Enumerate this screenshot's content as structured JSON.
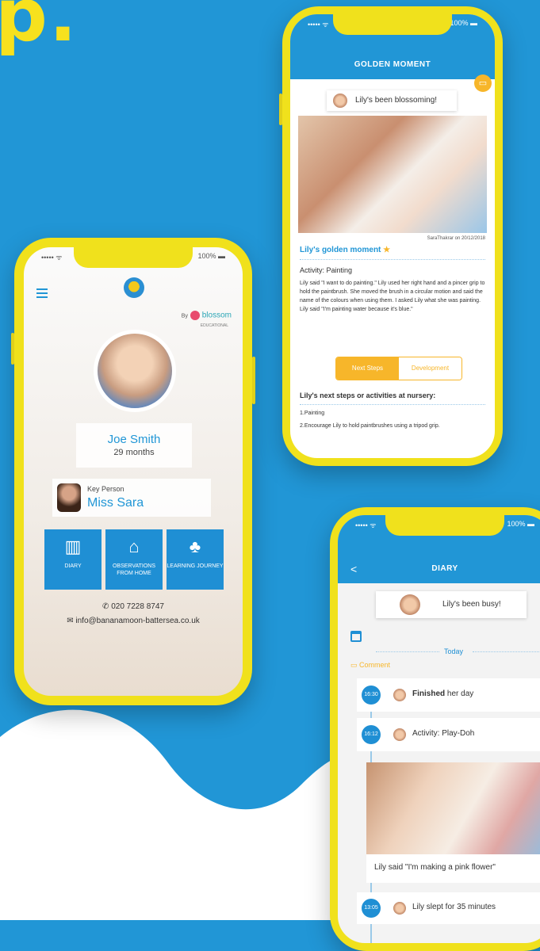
{
  "headline": "p.",
  "phone_profile": {
    "status": {
      "signal": "•••••  ᯤ",
      "battery": "100% ▬"
    },
    "brand": {
      "by_label": "By",
      "name": "blossom",
      "sub": "EDUCATIONAL"
    },
    "child": {
      "name": "Joe Smith",
      "age": "29 months"
    },
    "key_person": {
      "label": "Key Person",
      "name": "Miss Sara"
    },
    "tiles": [
      {
        "label": "DIARY",
        "icon": "notebook-icon"
      },
      {
        "label": "OBSERVATIONS FROM HOME",
        "icon": "house-icon"
      },
      {
        "label": "LEARNING JOURNEY",
        "icon": "tree-icon"
      }
    ],
    "contact": {
      "phone": "020 7228 8747",
      "email": "info@bananamoon-battersea.co.uk"
    }
  },
  "phone_moment": {
    "status": {
      "signal": "•••••  ᯤ",
      "battery": "100% ▬"
    },
    "title": "GOLDEN MOMENT",
    "summary": "Lily's been blossoming!",
    "photo_credit": "SaraThakrar on 20/12/2018",
    "moment_title": "Lily's golden moment",
    "activity": "Activity: Painting",
    "description": "Lily said \"I want to do painting.\" Lily used her right hand and a pincer grip to hold the paintbrush. She moved the brush in a circular motion and said the name of the colours when using them. I asked Lily what she was painting. Lily said \"I'm painting water because it's blue.\"",
    "tabs": [
      "Next Steps",
      "Development"
    ],
    "next_steps_title": "Lily's next steps or activities at nursery:",
    "next_steps": [
      "1.Painting",
      "2.Encourage Lily to hold paintbrushes using a tripod grip."
    ]
  },
  "phone_diary": {
    "status": {
      "signal": "•••••  ᯤ",
      "battery": "100% ▬"
    },
    "title": "DIARY",
    "back": "<",
    "summary": "Lily's been busy!",
    "today": "Today",
    "comment": "Comment",
    "entries": [
      {
        "time": "16:30",
        "bold": "Finished",
        "text": " her day"
      },
      {
        "time": "16:12",
        "bold": "",
        "text": "Activity: Play-Doh"
      },
      {
        "time": "13:05",
        "bold": "",
        "text": "Lily slept for 35 minutes"
      }
    ],
    "quote": "Lily said \"I'm making a pink flower\""
  },
  "colors": {
    "background": "#2196d6",
    "phone_frame": "#f0e11c",
    "accent_orange": "#f7b62a",
    "brand_blue": "#1f8fd4"
  }
}
